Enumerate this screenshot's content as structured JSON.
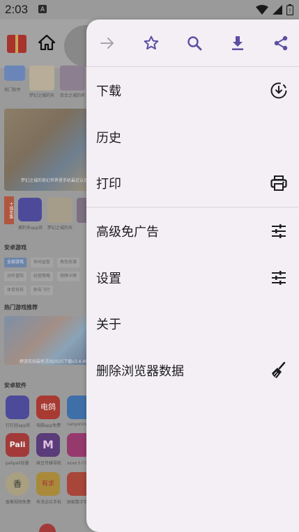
{
  "status_bar": {
    "time": "2:03",
    "notif_letter": "A"
  },
  "background_app": {
    "strip1_labels": [
      "热门软件",
      "梦幻之城的天",
      "百合之城的天"
    ],
    "banner_caption": "梦幻之城的奇幻世界里手机最近认识",
    "side_badge": "十城年集",
    "row2_labels": [
      "蛋利多app官",
      "梦幻之城的天"
    ],
    "android_games": "安卓游戏",
    "chips": [
      "全部游戏",
      "休闲益智",
      "角色扮演",
      "动作冒险",
      "经营策略",
      "棋牌卡牌",
      "模拟养成",
      "体育竞技",
      "射击飞行"
    ],
    "hot_games": "热门游戏推荐",
    "banner2_caption": "碧蓝航线最新活动2025下载v3.4.400 安卓版",
    "android_apps": "安卓软件",
    "app_labels": [
      "钉钉轻app官",
      "电脑app免费",
      "canyoning",
      "palipali轻量",
      "麻豆传媒导航",
      "xxxx十八禁",
      "香蕉视频免费",
      "有求必应手机",
      "国家数字货币"
    ],
    "app_texts": [
      "电鸽",
      "Pali",
      "M",
      "香",
      "有求"
    ]
  },
  "menu": {
    "toolbar": [
      {
        "name": "forward-button",
        "icon": "arrow-forward-icon",
        "enabled": false
      },
      {
        "name": "bookmark-button",
        "icon": "star-outline-icon",
        "enabled": true
      },
      {
        "name": "find-in-page-button",
        "icon": "search-icon",
        "enabled": true
      },
      {
        "name": "download-page-button",
        "icon": "download-icon",
        "enabled": true
      },
      {
        "name": "share-button",
        "icon": "share-icon",
        "enabled": true
      }
    ],
    "items": [
      {
        "label": "下载",
        "icon": "download-circle-icon"
      },
      {
        "label": "历史",
        "icon": ""
      },
      {
        "label": "打印",
        "icon": "printer-icon"
      },
      {
        "label": "高级免广告",
        "icon": "tune-icon"
      },
      {
        "label": "设置",
        "icon": "tune-icon"
      },
      {
        "label": "关于",
        "icon": ""
      },
      {
        "label": "删除浏览器数据",
        "icon": "broom-icon"
      }
    ],
    "colors": {
      "accent": "#5b4fa3",
      "disabled": "#a7a3ad",
      "text": "#1c1b1f",
      "panel": "#f3eff5"
    }
  }
}
